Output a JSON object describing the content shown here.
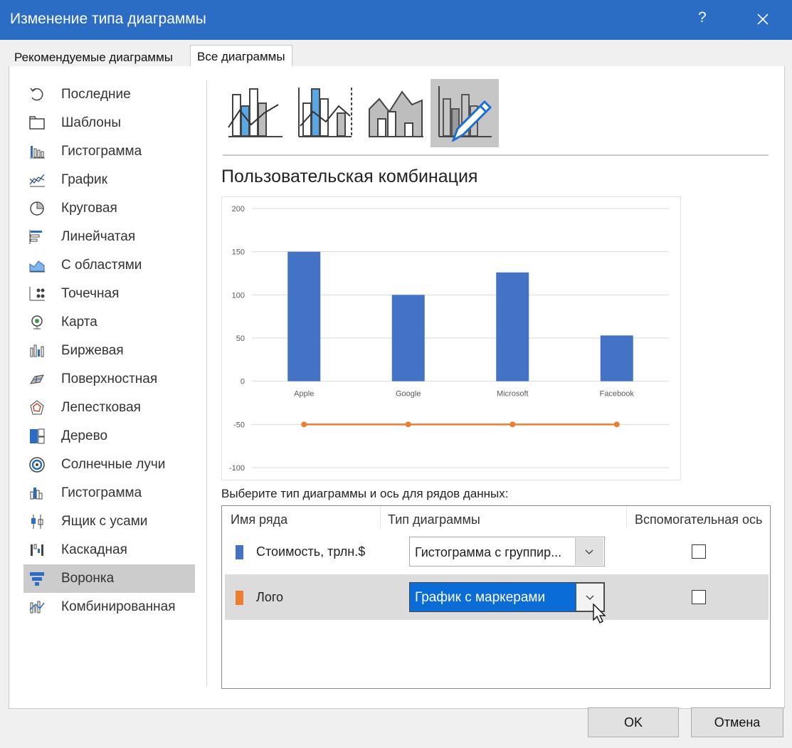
{
  "window": {
    "title": "Изменение типа диаграммы",
    "help": "?"
  },
  "tabs": [
    {
      "label": "Рекомендуемые диаграммы"
    },
    {
      "label": "Все диаграммы"
    }
  ],
  "sidebar": {
    "selected_index": 17,
    "items": [
      {
        "label": "Последние",
        "icon": "recent-icon"
      },
      {
        "label": "Шаблоны",
        "icon": "folder-icon"
      },
      {
        "label": "Гистограмма",
        "icon": "column-chart-icon"
      },
      {
        "label": "График",
        "icon": "line-chart-icon"
      },
      {
        "label": "Круговая",
        "icon": "pie-chart-icon"
      },
      {
        "label": "Линейчатая",
        "icon": "bar-chart-icon"
      },
      {
        "label": "С областями",
        "icon": "area-chart-icon"
      },
      {
        "label": "Точечная",
        "icon": "scatter-chart-icon"
      },
      {
        "label": "Карта",
        "icon": "map-chart-icon"
      },
      {
        "label": "Биржевая",
        "icon": "stock-chart-icon"
      },
      {
        "label": "Поверхностная",
        "icon": "surface-chart-icon"
      },
      {
        "label": "Лепестковая",
        "icon": "radar-chart-icon"
      },
      {
        "label": "Дерево",
        "icon": "treemap-chart-icon"
      },
      {
        "label": "Солнечные лучи",
        "icon": "sunburst-chart-icon"
      },
      {
        "label": "Гистограмма",
        "icon": "histogram-chart-icon"
      },
      {
        "label": "Ящик с усами",
        "icon": "box-whisker-chart-icon"
      },
      {
        "label": "Каскадная",
        "icon": "waterfall-chart-icon"
      },
      {
        "label": "Воронка",
        "icon": "funnel-chart-icon"
      },
      {
        "label": "Комбинированная",
        "icon": "combo-chart-icon"
      }
    ]
  },
  "subtypes": [
    {
      "icon": "combo-column-line-icon"
    },
    {
      "icon": "combo-column-line-secondary-icon"
    },
    {
      "icon": "combo-area-column-icon"
    },
    {
      "icon": "combo-custom-icon",
      "selected": true
    }
  ],
  "combo_title": "Пользовательская комбинация",
  "chart_data": {
    "type": "bar",
    "categories": [
      "Apple",
      "Google",
      "Microsoft",
      "Facebook"
    ],
    "series": [
      {
        "name": "Стоимость, трлн.$",
        "type": "bar",
        "values": [
          150,
          100,
          126,
          53
        ],
        "color": "#4472c4"
      },
      {
        "name": "Лого",
        "type": "line",
        "values": [
          -50,
          -50,
          -50,
          -50
        ],
        "color": "#ed7d31"
      }
    ],
    "yticks": [
      200,
      150,
      100,
      50,
      0,
      -50,
      -100
    ],
    "ylim": [
      -100,
      200
    ],
    "grid": true
  },
  "instruction": "Выберите тип диаграммы и ось для рядов данных:",
  "grid": {
    "headers": {
      "name": "Имя ряда",
      "type": "Тип диаграммы",
      "axis": "Вспомогательная ось"
    },
    "rows": [
      {
        "name": "Стоимость, трлн.$",
        "color": "#4472c4",
        "type": "Гистограмма с группир...",
        "secondary_axis": false
      },
      {
        "name": "Лого",
        "color": "#ed7d31",
        "type": "График с маркерами",
        "secondary_axis": false
      }
    ]
  },
  "buttons": {
    "ok": "OK",
    "cancel": "Отмена"
  }
}
